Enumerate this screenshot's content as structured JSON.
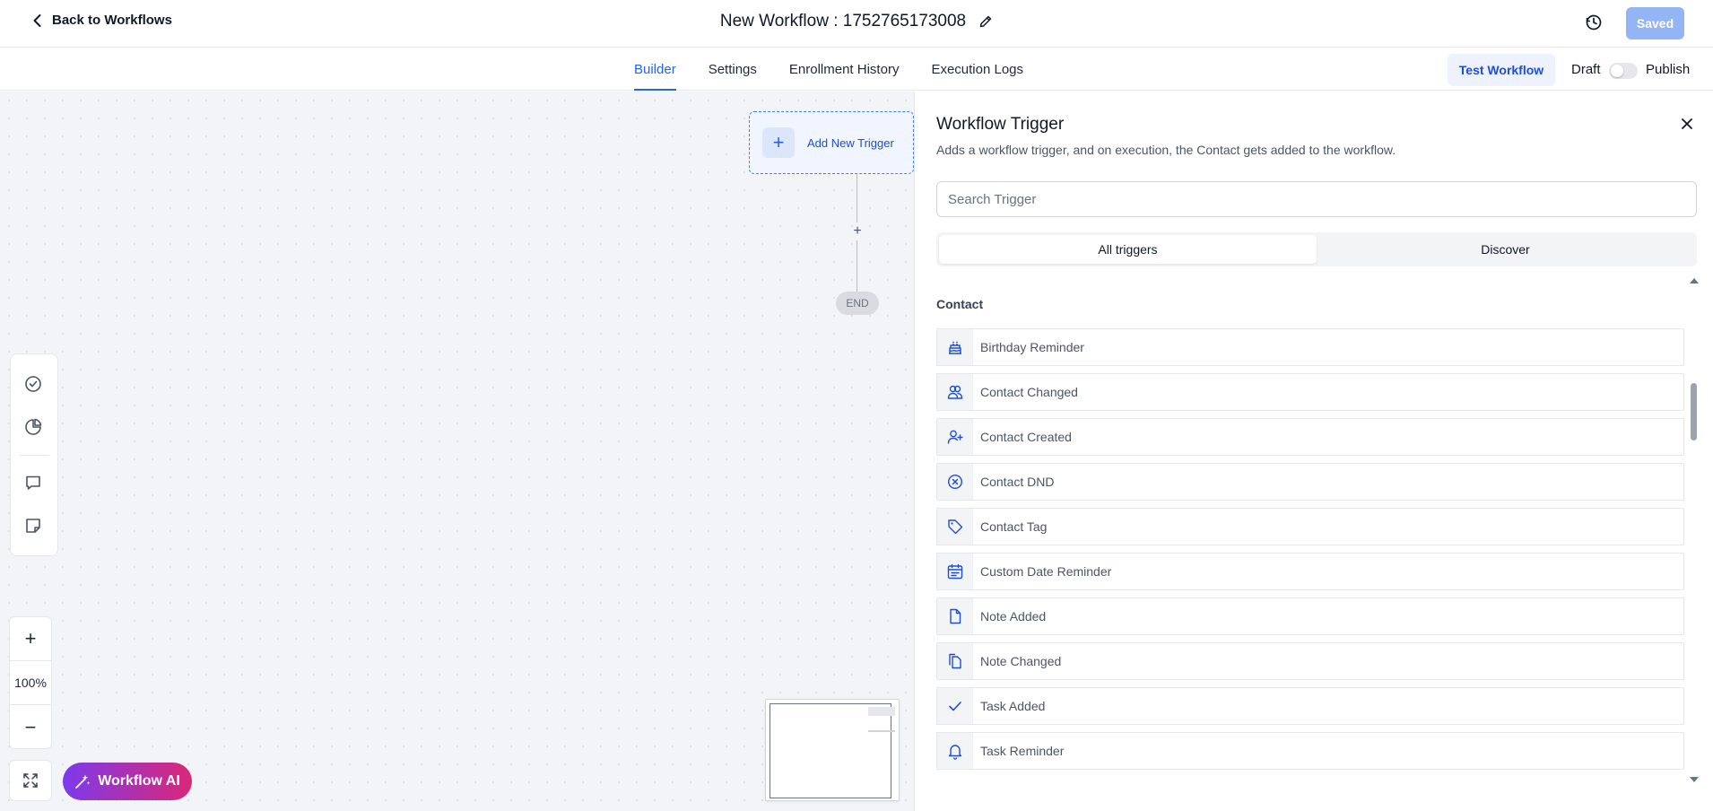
{
  "header": {
    "back_label": "Back to Workflows",
    "workflow_title": "New Workflow : 1752765173008",
    "saved_label": "Saved"
  },
  "tabs": [
    {
      "label": "Builder",
      "active": true
    },
    {
      "label": "Settings",
      "active": false
    },
    {
      "label": "Enrollment History",
      "active": false
    },
    {
      "label": "Execution Logs",
      "active": false
    }
  ],
  "actions": {
    "test_label": "Test Workflow",
    "draft_label": "Draft",
    "publish_label": "Publish",
    "publish_on": false
  },
  "canvas": {
    "add_trigger_label": "Add New Trigger",
    "end_label": "END",
    "zoom_level": "100%",
    "ai_label": "Workflow AI"
  },
  "panel": {
    "title": "Workflow Trigger",
    "description": "Adds a workflow trigger, and on execution, the Contact gets added to the workflow.",
    "search_placeholder": "Search Trigger",
    "segments": [
      {
        "label": "All triggers",
        "active": true
      },
      {
        "label": "Discover",
        "active": false
      }
    ],
    "section_title": "Contact",
    "items": [
      {
        "label": "Birthday Reminder",
        "icon": "cake-icon"
      },
      {
        "label": "Contact Changed",
        "icon": "users-icon"
      },
      {
        "label": "Contact Created",
        "icon": "user-plus-icon"
      },
      {
        "label": "Contact DND",
        "icon": "x-circle-icon"
      },
      {
        "label": "Contact Tag",
        "icon": "tag-icon"
      },
      {
        "label": "Custom Date Reminder",
        "icon": "calendar-icon"
      },
      {
        "label": "Note Added",
        "icon": "file-icon"
      },
      {
        "label": "Note Changed",
        "icon": "copy-icon"
      },
      {
        "label": "Task Added",
        "icon": "check-icon"
      },
      {
        "label": "Task Reminder",
        "icon": "bell-icon"
      }
    ]
  },
  "colors": {
    "accent": "#2563eb",
    "icon": "#1d4ed8",
    "saved_button": "#93b4f5",
    "ai_gradient_start": "#7c3aed",
    "ai_gradient_end": "#db2777"
  }
}
